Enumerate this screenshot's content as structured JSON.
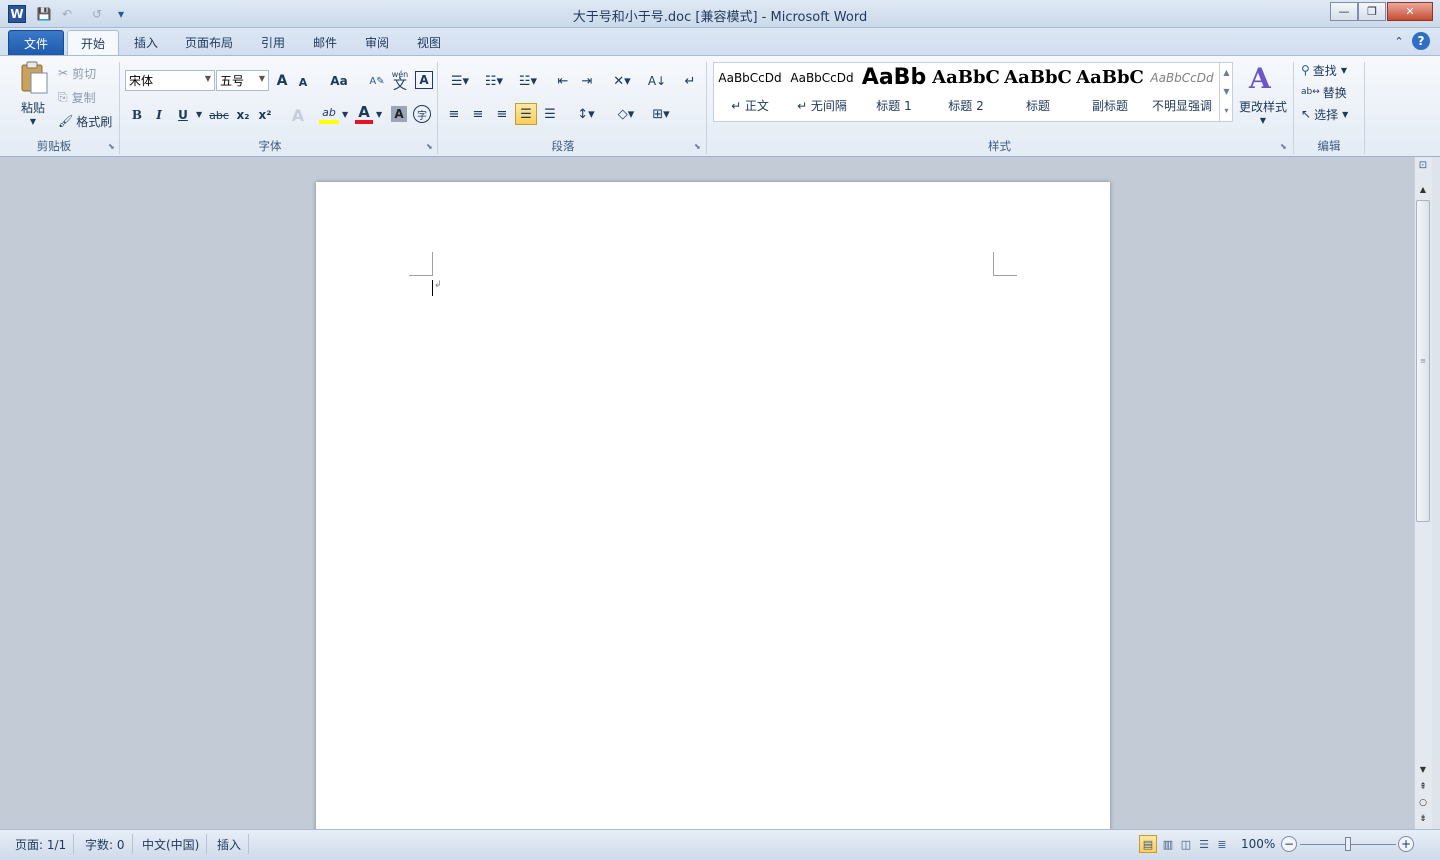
{
  "window": {
    "title": "大于号和小于号.doc [兼容模式] - Microsoft Word",
    "logo": "W",
    "minimize": "—",
    "restore": "❐",
    "close": "✕"
  },
  "quick_access": {
    "save_icon": "💾",
    "undo_icon": "↶",
    "redo_icon": "↺",
    "customize_icon": "▾"
  },
  "tabs": {
    "file": "文件",
    "items": [
      "开始",
      "插入",
      "页面布局",
      "引用",
      "邮件",
      "审阅",
      "视图"
    ]
  },
  "ribbon_corner": {
    "minimize_icon": "⌃",
    "help_icon": "?"
  },
  "clipboard": {
    "paste": "粘贴",
    "cut": "剪切",
    "copy": "复制",
    "format_painter": "格式刷",
    "label": "剪贴板"
  },
  "font": {
    "name": "宋体",
    "size": "五号",
    "grow": "A",
    "shrink": "A",
    "change_case": "Aa",
    "bold": "B",
    "italic": "I",
    "underline": "U",
    "strike": "abc",
    "subscript": "x₂",
    "superscript": "x²",
    "text_effects": "A",
    "highlight": "ab",
    "font_color": "A",
    "char_shading": "A",
    "enclose": "字",
    "phonetic": "wén",
    "phonetic_char": "文",
    "char_border": "A",
    "label": "字体"
  },
  "paragraph": {
    "label": "段落"
  },
  "styles": {
    "items": [
      {
        "sample": "AaBbCcDd",
        "name": "↵ 正文"
      },
      {
        "sample": "AaBbCcDd",
        "name": "↵ 无间隔"
      },
      {
        "sample": "AaBb",
        "name": "标题 1"
      },
      {
        "sample": "AaBbC",
        "name": "标题 2"
      },
      {
        "sample": "AaBbC",
        "name": "标题"
      },
      {
        "sample": "AaBbC",
        "name": "副标题"
      },
      {
        "sample": "AaBbCcDd",
        "name": "不明显强调"
      }
    ],
    "change_styles": "更改样式",
    "label": "样式"
  },
  "editing": {
    "find": "查找",
    "replace": "替换",
    "select": "选择",
    "label": "编辑"
  },
  "status": {
    "page": "页面: 1/1",
    "words": "字数: 0",
    "language": "中文(中国)",
    "mode": "插入",
    "zoom": "100%",
    "zoom_minus": "−",
    "zoom_plus": "+"
  },
  "colors": {
    "accent": "#2b579a",
    "highlight": "#ffff00",
    "font_color": "#e81123"
  }
}
